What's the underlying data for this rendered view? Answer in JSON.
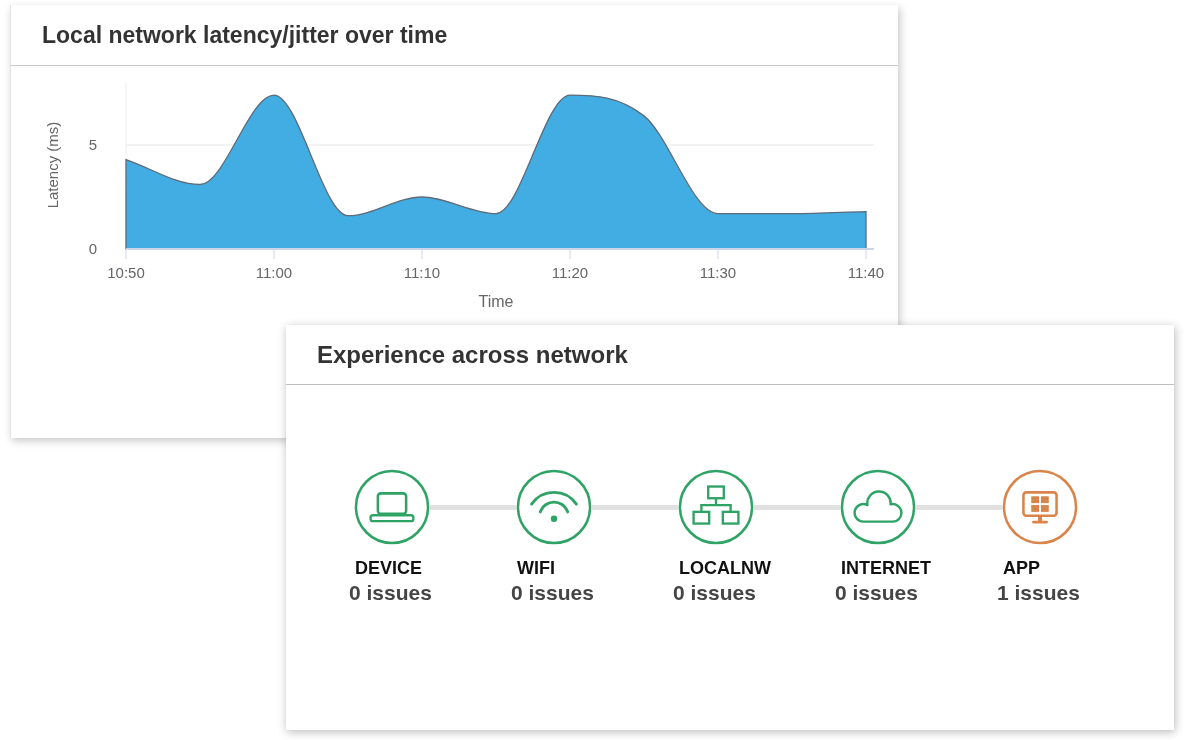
{
  "latency_card": {
    "title": "Local network latency/jitter over time",
    "chart_data": {
      "type": "area",
      "xlabel": "Time",
      "ylabel": "Latency (ms)",
      "categories": [
        "10:50",
        null,
        "11:00",
        null,
        "11:10",
        null,
        "11:20",
        null,
        "11:30",
        null,
        "11:40"
      ],
      "series": [
        {
          "color": "#42ade2",
          "values": [
            4.3,
            3.1,
            7.4,
            1.6,
            2.5,
            1.7,
            7.4,
            6.4,
            1.7,
            1.7,
            1.8
          ]
        }
      ],
      "ylim": [
        0,
        8
      ],
      "yticks": [
        0,
        5
      ]
    }
  },
  "experience_card": {
    "title": "Experience across network",
    "nodes": [
      {
        "kind": "device",
        "label": "DEVICE",
        "issues": "0 issues",
        "color": "#2fa365"
      },
      {
        "kind": "wifi",
        "label": "WIFI",
        "issues": "0 issues",
        "color": "#2fa365"
      },
      {
        "kind": "localnw",
        "label": "LOCALNW",
        "issues": "0 issues",
        "color": "#2fa365"
      },
      {
        "kind": "internet",
        "label": "INTERNET",
        "issues": "0 issues",
        "color": "#2fa365"
      },
      {
        "kind": "app",
        "label": "APP",
        "issues": "1 issues",
        "color": "#d9844a"
      }
    ]
  }
}
